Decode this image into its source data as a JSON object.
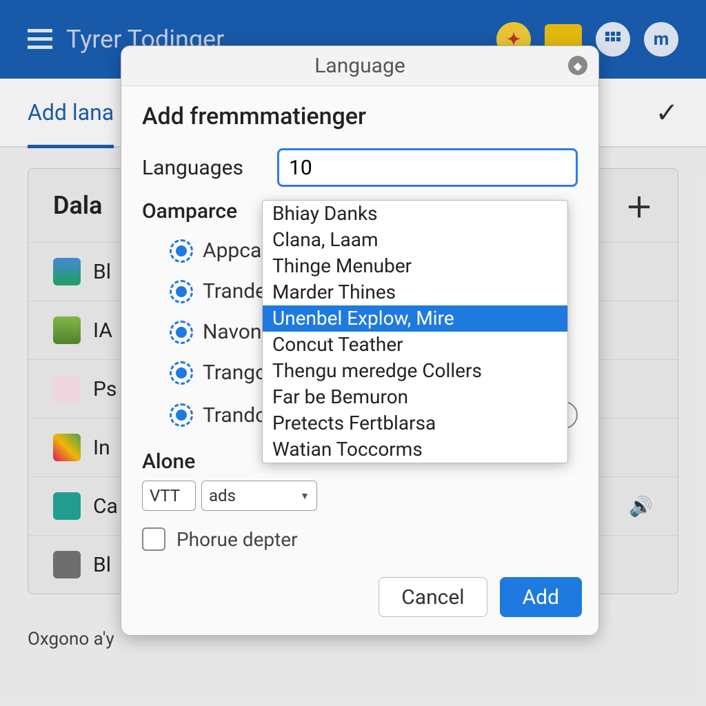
{
  "header": {
    "title": "Tyrer Todinger"
  },
  "tabs": {
    "active_label": "Add lana"
  },
  "panel": {
    "title": "Dala",
    "items": [
      {
        "label": "Bl"
      },
      {
        "label": "IA"
      },
      {
        "label": "Ps"
      },
      {
        "label": "In"
      },
      {
        "label": "Ca"
      },
      {
        "label": "Bl"
      }
    ]
  },
  "footer": "Oxgono a'y",
  "modal": {
    "window_title": "Language",
    "heading": "Add fremmmatienger",
    "languages_label": "Languages",
    "languages_value": "10",
    "dropdown_options": [
      "Bhiay Danks",
      "Clana, Laam",
      "Thinge Menuber",
      "Marder Thines",
      "Unenbel Explow, Mire",
      "Concut Teather",
      "Thengu meredge Collers",
      "Far be Bemuron",
      "Pretects Fertblarsa",
      "Watian Toccorms"
    ],
    "dropdown_selected_index": 4,
    "section2_heading": "Oamparce",
    "radios": [
      {
        "label": "Appcal"
      },
      {
        "label": "Trande"
      },
      {
        "label": "Navoni"
      },
      {
        "label": "Trango"
      },
      {
        "label": "Trandode"
      }
    ],
    "alone_heading": "Alone",
    "alone_field1": "VTT",
    "alone_field2": "ads",
    "checkbox_label": "Phorue depter",
    "cancel": "Cancel",
    "add": "Add"
  }
}
